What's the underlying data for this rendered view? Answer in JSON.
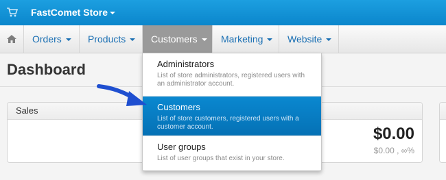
{
  "topbar": {
    "store_name": "FastComet Store"
  },
  "nav": {
    "items": [
      {
        "label": "Orders"
      },
      {
        "label": "Products"
      },
      {
        "label": "Customers"
      },
      {
        "label": "Marketing"
      },
      {
        "label": "Website"
      }
    ]
  },
  "page": {
    "title": "Dashboard"
  },
  "sales": {
    "header": "Sales",
    "value": "$0.00",
    "subvalue": "$0.00 , ∞%"
  },
  "dropdown": {
    "items": [
      {
        "title": "Administrators",
        "desc": "List of store administrators, registered users with an administrator account."
      },
      {
        "title": "Customers",
        "desc": "List of store customers, registered users with a customer account."
      },
      {
        "title": "User groups",
        "desc": "List of user groups that exist in your store."
      }
    ]
  },
  "colors": {
    "accent": "#0a88d0",
    "topbar": "#1c9fe0",
    "arrow": "#1f4fd0"
  }
}
